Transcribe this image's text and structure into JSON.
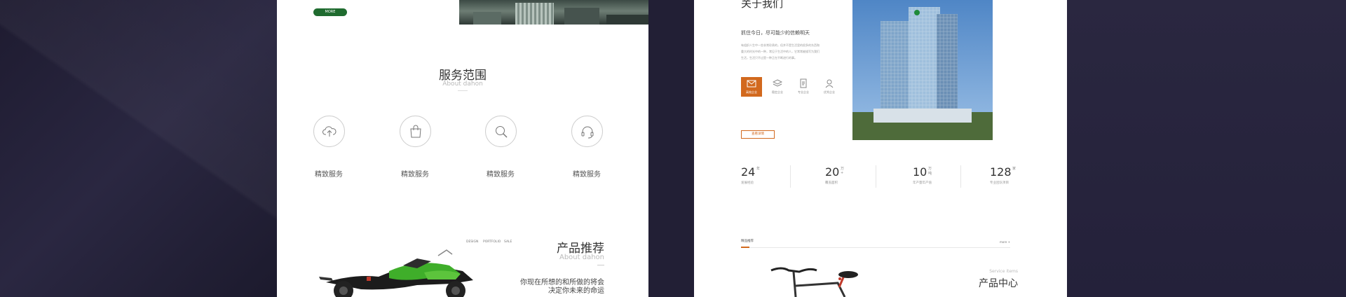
{
  "left_page": {
    "more_button": "MORE",
    "services": {
      "title": "服务范围",
      "subtitle": "About dahon",
      "items": [
        {
          "label": "精致服务",
          "icon": "cloud-upload-icon"
        },
        {
          "label": "精致服务",
          "icon": "shopping-bag-icon"
        },
        {
          "label": "精致服务",
          "icon": "search-icon"
        },
        {
          "label": "精致服务",
          "icon": "headset-icon"
        }
      ]
    },
    "product_nav": [
      "DESIGN",
      "PORTFOLIO",
      "SALE"
    ],
    "product": {
      "title": "产品推荐",
      "subtitle": "About dahon",
      "line1": "你现在所想的和所做的将会",
      "line2": "决定你未来的命运"
    }
  },
  "right_page": {
    "about": {
      "title": "关于我们",
      "slogan": "抓住今日，尽可能少的信赖明天",
      "paragraph_lines": [
        "有组织人生中一些非常珍贵的，但并不是生活里的很多的东西和",
        "重大的时光中的一种，常见于生活中的人，它常常被描写为我们",
        "生活，生活只不过是一种正在不断进行的事。"
      ],
      "features": [
        {
          "label": "高效企业",
          "icon": "mail-icon",
          "active": true
        },
        {
          "label": "稳定企业",
          "icon": "layers-icon",
          "active": false
        },
        {
          "label": "专业企业",
          "icon": "document-icon",
          "active": false
        },
        {
          "label": "优秀企业",
          "icon": "user-icon",
          "active": false
        }
      ],
      "more_button": "查看详情"
    },
    "stats": [
      {
        "number": "24",
        "unit": "年",
        "label": "发展经验"
      },
      {
        "number": "20",
        "unit": "万+",
        "label": "覆盖面积"
      },
      {
        "number": "10",
        "unit": "万吨",
        "label": "年产量年产值"
      },
      {
        "number": "128",
        "unit": "家",
        "label": "专业团队项目"
      }
    ],
    "tabs": {
      "active": "精品推荐",
      "more": "more +"
    },
    "product_center": {
      "subtitle": "Service items",
      "title": "产品中心"
    }
  },
  "colors": {
    "background": "#221f35",
    "accent_green": "#1f6b2f",
    "accent_orange": "#d2691e"
  }
}
